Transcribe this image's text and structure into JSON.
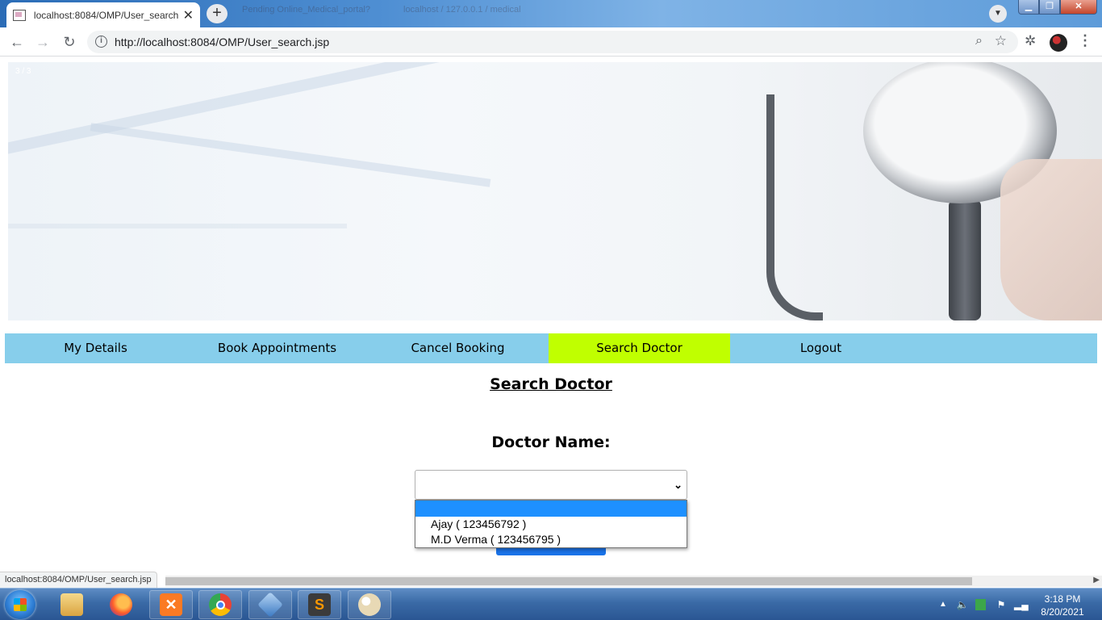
{
  "browser": {
    "active_tab_title": "localhost:8084/OMP/User_search",
    "close_glyph": "✕",
    "new_tab_glyph": "+",
    "background_tabs": [
      "Pending Online_Medical_portal?",
      "localhost / 127.0.0.1 / medical"
    ],
    "url": "http://localhost:8084/OMP/User_search.jsp",
    "back_glyph": "←",
    "forward_glyph": "→",
    "reload_glyph": "↻",
    "menu_glyph": "⋮"
  },
  "banner": {
    "slide_counter": "3 / 3"
  },
  "nav": {
    "items": [
      {
        "label": "My Details"
      },
      {
        "label": "Book Appointments"
      },
      {
        "label": "Cancel Booking"
      },
      {
        "label": "Search Doctor"
      },
      {
        "label": "Logout"
      }
    ],
    "active_color": "#c0ff00",
    "bar_color": "#87ceeb"
  },
  "main": {
    "heading": "Search Doctor",
    "doctor_label": "Doctor Name:",
    "select_value": "",
    "options": [
      "",
      "Ajay ( 123456792 )",
      "M.D Verma ( 123456795 )"
    ],
    "highlight_color": "#1e90ff"
  },
  "status_bar": {
    "url": "localhost:8084/OMP/User_search.jsp"
  },
  "taskbar": {
    "apps": [
      "windows-explorer",
      "firefox",
      "xampp",
      "chrome",
      "virtualbox",
      "sublime-text",
      "paint"
    ],
    "clock_time": "3:18 PM",
    "clock_date": "8/20/2021"
  }
}
